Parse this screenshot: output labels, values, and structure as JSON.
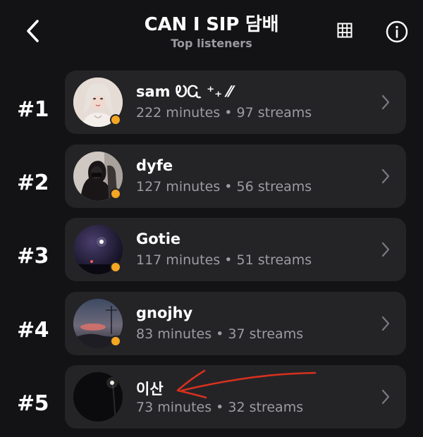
{
  "header": {
    "title": "CAN I SIP 담배",
    "subtitle": "Top listeners",
    "back_icon": "chevron-left-icon",
    "grid_icon": "grid-icon",
    "info_icon": "info-icon"
  },
  "listeners": [
    {
      "rank": "#1",
      "name": "sam ᎧᏩ ⁺₊ ⁄⁄",
      "stats": "222 minutes • 97 streams",
      "online": true
    },
    {
      "rank": "#2",
      "name": "dyfe",
      "stats": "127 minutes • 56 streams",
      "online": true
    },
    {
      "rank": "#3",
      "name": "Gotie",
      "stats": "117 minutes • 51 streams",
      "online": true
    },
    {
      "rank": "#4",
      "name": "gnojhy",
      "stats": "83 minutes • 37 streams",
      "online": true
    },
    {
      "rank": "#5",
      "name": "이산",
      "stats": "73 minutes • 32 streams",
      "online": false
    }
  ],
  "colors": {
    "background": "#131315",
    "card": "#242427",
    "status_dot": "#f5a623",
    "annotation": "#d8301e"
  }
}
